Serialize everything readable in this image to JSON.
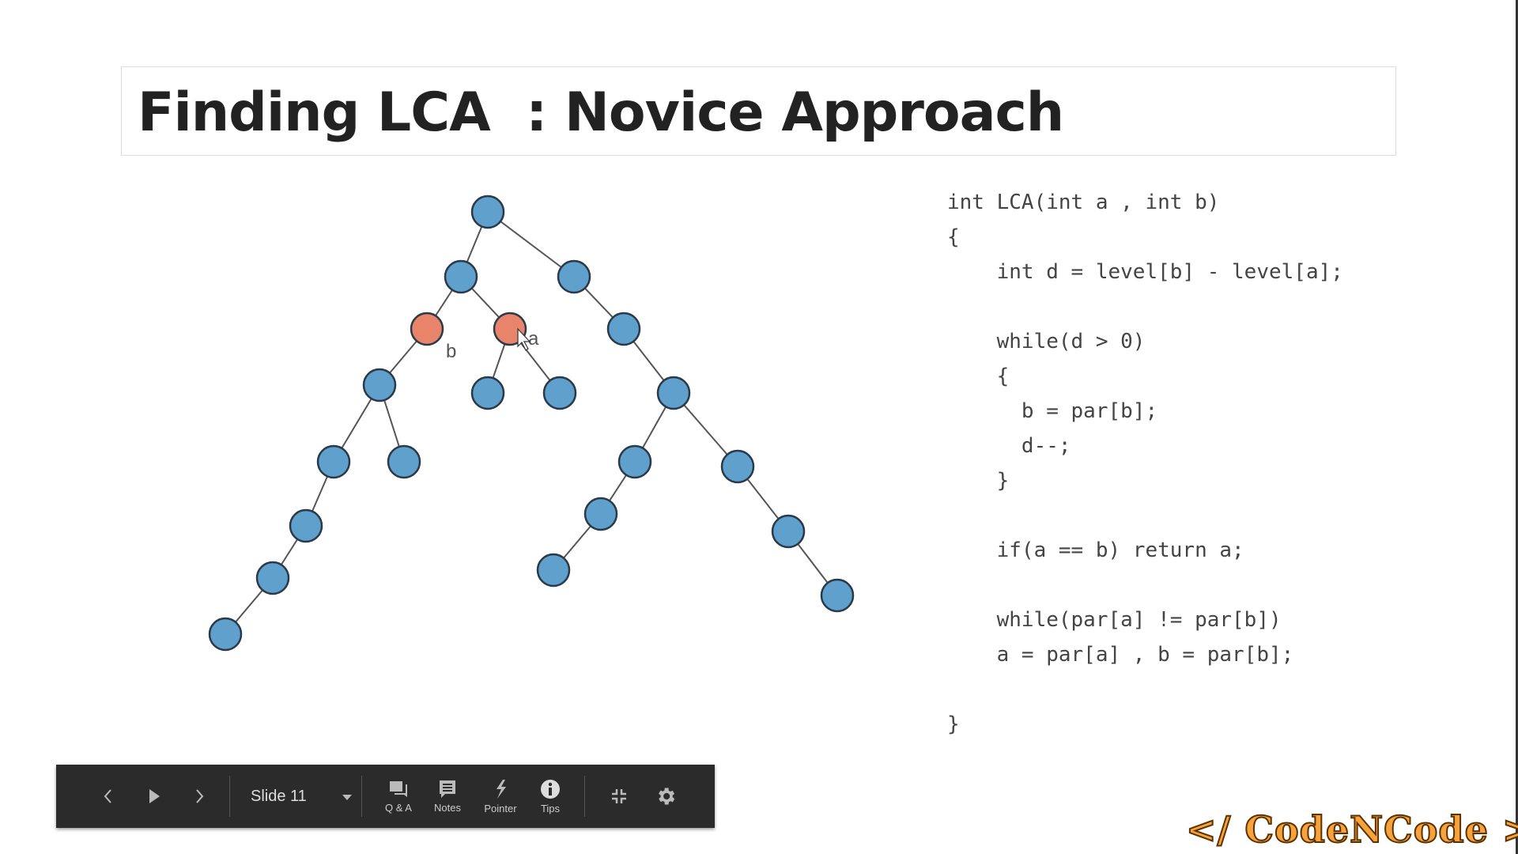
{
  "slide": {
    "title": "Finding LCA  : Novice Approach"
  },
  "tree": {
    "node_color": "#5fa0cc",
    "highlight_color": "#e8846a",
    "labels": {
      "b": "b",
      "a": "a"
    }
  },
  "code": {
    "lines": [
      "int LCA(int a , int b)",
      "{",
      "    int d = level[b] - level[a];",
      "",
      "    while(d > 0)",
      "    {",
      "      b = par[b];",
      "      d--;",
      "    }",
      "",
      "    if(a == b) return a;",
      "",
      "    while(par[a] != par[b])",
      "    a = par[a] , b = par[b];",
      "",
      "}"
    ]
  },
  "toolbar": {
    "slide_label": "Slide 11",
    "qa": "Q & A",
    "notes": "Notes",
    "pointer": "Pointer",
    "tips": "Tips"
  },
  "logo": {
    "text": "</ CodeNCode >"
  }
}
